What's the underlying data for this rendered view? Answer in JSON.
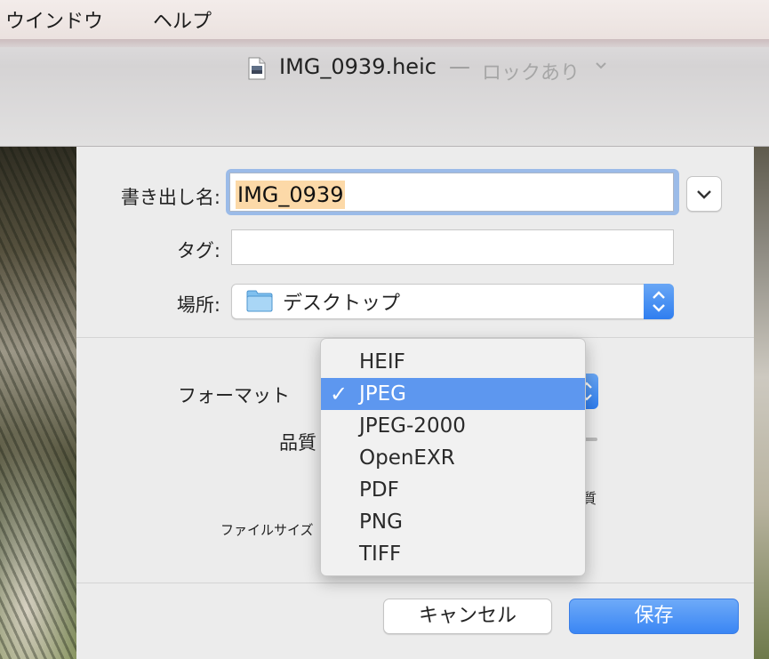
{
  "menubar": {
    "items": [
      "ウインドウ",
      "ヘルプ"
    ]
  },
  "window": {
    "filename": "IMG_0939.heic",
    "separator": "—",
    "lock_status": "ロックあり"
  },
  "dialog": {
    "name_label": "書き出し名:",
    "name_value": "IMG_0939",
    "tag_label": "タグ:",
    "tag_value": "",
    "location_label": "場所:",
    "location_value": "デスクトップ",
    "format_label": "フォーマット",
    "quality_label": "品質",
    "quality_high": "質",
    "filesize_label": "ファイルサイズ",
    "format_options": [
      "HEIF",
      "JPEG",
      "JPEG-2000",
      "OpenEXR",
      "PDF",
      "PNG",
      "TIFF"
    ],
    "format_selected": "JPEG",
    "check_mark": "✓",
    "cancel_label": "キャンセル",
    "save_label": "保存"
  },
  "colors": {
    "accent": "#5d97ef",
    "name_highlight": "#fcd9a8"
  }
}
